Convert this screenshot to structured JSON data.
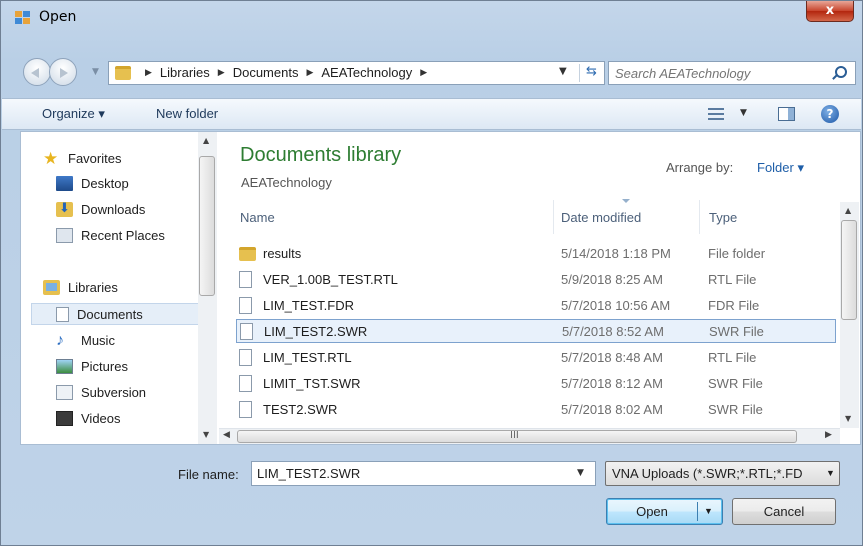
{
  "window": {
    "title": "Open",
    "close_label": "x"
  },
  "address": {
    "crumbs": [
      "Libraries",
      "Documents",
      "AEATechnology"
    ],
    "search_placeholder": "Search AEATechnology"
  },
  "toolbar": {
    "organize": "Organize ▾",
    "new_folder": "New folder",
    "help": "?"
  },
  "nav": {
    "favorites": "Favorites",
    "desktop": "Desktop",
    "downloads": "Downloads",
    "recent": "Recent Places",
    "libraries": "Libraries",
    "documents": "Documents",
    "music": "Music",
    "pictures": "Pictures",
    "subversion": "Subversion",
    "videos": "Videos"
  },
  "library": {
    "title": "Documents library",
    "subtitle": "AEATechnology",
    "arrange_label": "Arrange by:",
    "arrange_value": "Folder ▾"
  },
  "columns": {
    "name": "Name",
    "date": "Date modified",
    "type": "Type"
  },
  "files": [
    {
      "name": "results",
      "date": "5/14/2018 1:18 PM",
      "type": "File folder"
    },
    {
      "name": "VER_1.00B_TEST.RTL",
      "date": "5/9/2018 8:25 AM",
      "type": "RTL File"
    },
    {
      "name": "LIM_TEST.FDR",
      "date": "5/7/2018 10:56 AM",
      "type": "FDR File"
    },
    {
      "name": "LIM_TEST2.SWR",
      "date": "5/7/2018 8:52 AM",
      "type": "SWR File"
    },
    {
      "name": "LIM_TEST.RTL",
      "date": "5/7/2018 8:48 AM",
      "type": "RTL File"
    },
    {
      "name": "LIMIT_TST.SWR",
      "date": "5/7/2018 8:12 AM",
      "type": "SWR File"
    },
    {
      "name": "TEST2.SWR",
      "date": "5/7/2018 8:02 AM",
      "type": "SWR File"
    }
  ],
  "bottom": {
    "file_name_label": "File name:",
    "file_name_value": "LIM_TEST2.SWR",
    "filter": "VNA Uploads (*.SWR;*.RTL;*.FD",
    "open": "Open",
    "cancel": "Cancel"
  },
  "hscroll_label": "III",
  "colors": {
    "accent": "#2e7d32",
    "selection": "#e8f1fb"
  }
}
